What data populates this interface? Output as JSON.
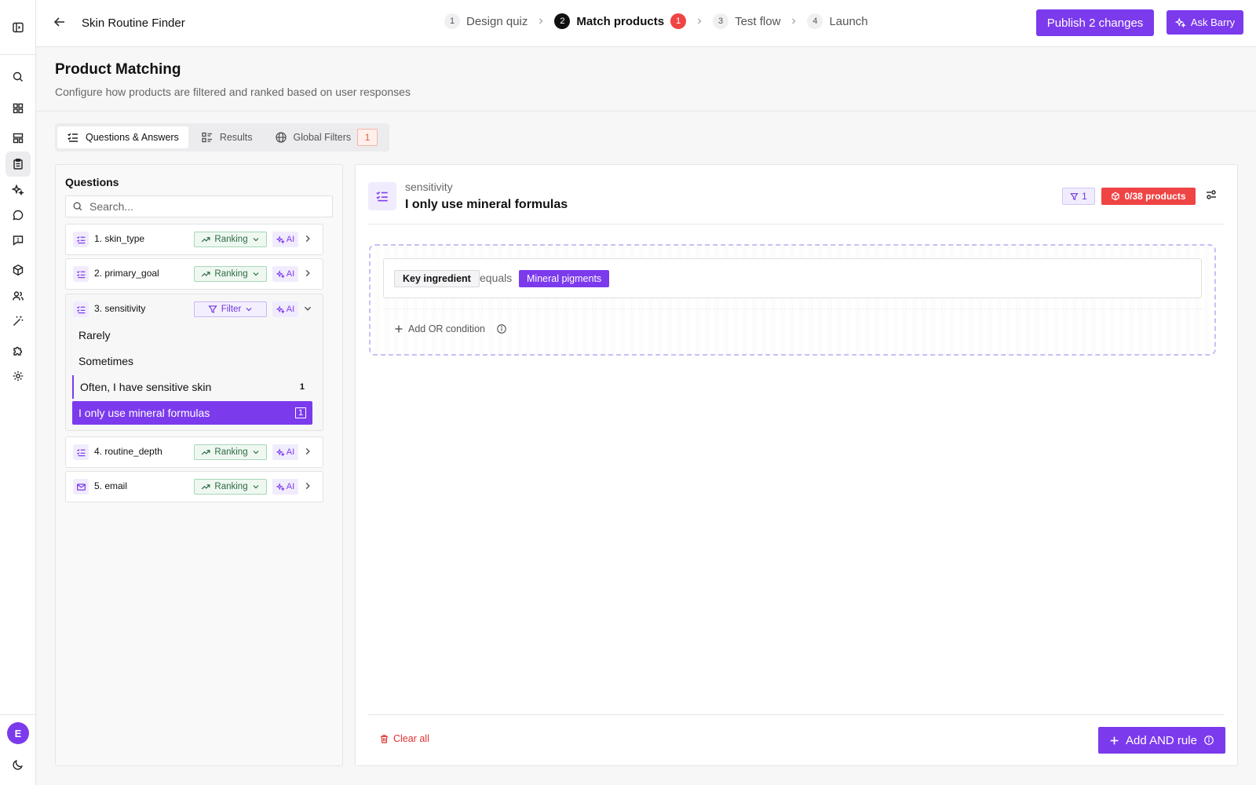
{
  "header": {
    "app_title": "Skin Routine Finder",
    "steps": [
      {
        "num": "1",
        "label": "Design quiz"
      },
      {
        "num": "2",
        "label": "Match products",
        "badge": "1"
      },
      {
        "num": "3",
        "label": "Test flow"
      },
      {
        "num": "4",
        "label": "Launch"
      }
    ],
    "active_step": 2,
    "publish_label": "Publish 2 changes",
    "ask_label": "Ask Barry"
  },
  "page": {
    "title": "Product Matching",
    "subtitle": "Configure how products are filtered and ranked based on user responses"
  },
  "tabs": [
    {
      "label": "Questions & Answers",
      "icon": "checklist-icon",
      "active": true
    },
    {
      "label": "Results",
      "icon": "results-list-icon"
    },
    {
      "label": "Global Filters",
      "icon": "globe-icon",
      "count": "1"
    }
  ],
  "questions_panel": {
    "title": "Questions",
    "search_placeholder": "Search...",
    "ai_label": "AI",
    "questions": [
      {
        "label": "1. skin_type",
        "mode": "Ranking",
        "icon": "checklist-icon"
      },
      {
        "label": "2. primary_goal",
        "mode": "Ranking",
        "icon": "checklist-icon"
      },
      {
        "label": "3. sensitivity",
        "mode": "Filter",
        "icon": "checklist-icon",
        "expanded": true,
        "answers": [
          {
            "label": "Rarely"
          },
          {
            "label": "Sometimes"
          },
          {
            "label": "Often, I have sensitive skin",
            "count": "1"
          },
          {
            "label": "I only use mineral formulas",
            "count": "1",
            "selected": true
          }
        ]
      },
      {
        "label": "4. routine_depth",
        "mode": "Ranking",
        "icon": "checklist-icon"
      },
      {
        "label": "5. email",
        "mode": "Ranking",
        "icon": "mail-icon"
      }
    ]
  },
  "detail": {
    "kicker": "sensitivity",
    "title": "I only use mineral formulas",
    "filter_count": "1",
    "products_label": "0/38 products",
    "condition": {
      "field": "Key ingredient",
      "operator": "equals",
      "value": "Mineral pigments"
    },
    "add_or_label": "Add OR condition",
    "clear_all_label": "Clear all",
    "add_and_label": "Add AND rule"
  },
  "colors": {
    "accent": "#7c3aed",
    "danger": "#ef4444",
    "ranking_green": "#2f6b43"
  }
}
